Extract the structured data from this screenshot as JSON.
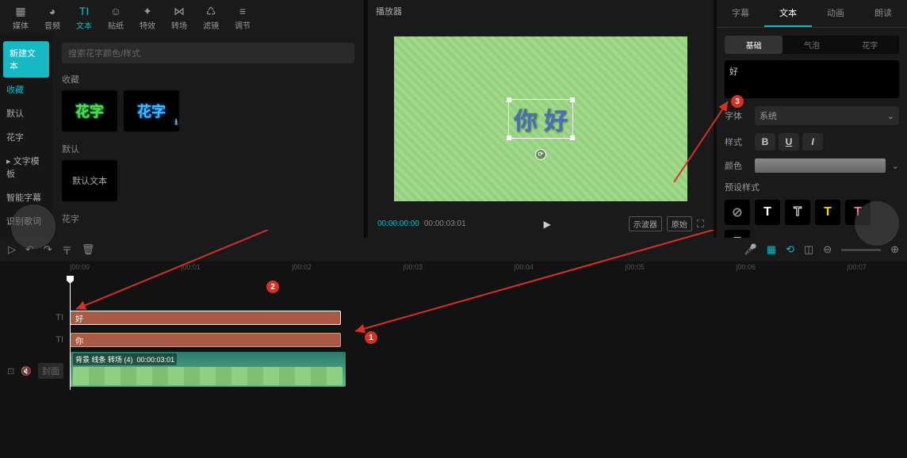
{
  "toolbar": [
    {
      "icon": "▦",
      "label": "媒体"
    },
    {
      "icon": "◕",
      "label": "音频"
    },
    {
      "icon": "TI",
      "label": "文本",
      "active": true
    },
    {
      "icon": "☺",
      "label": "贴纸"
    },
    {
      "icon": "✦",
      "label": "特效"
    },
    {
      "icon": "⋈",
      "label": "转场"
    },
    {
      "icon": "♺",
      "label": "滤镜"
    },
    {
      "icon": "≡",
      "label": "调节"
    }
  ],
  "sidebar": [
    {
      "label": "新建文本",
      "active": true
    },
    {
      "label": "收藏",
      "sel": true
    },
    {
      "label": "默认"
    },
    {
      "label": "花字"
    },
    {
      "label": "▸ 文字模板"
    },
    {
      "label": "智能字幕"
    },
    {
      "label": "识别歌词"
    }
  ],
  "search_placeholder": "搜索花字颜色/样式",
  "sections": {
    "fav": "收藏",
    "default": "默认",
    "huazi": "花字"
  },
  "assets": {
    "huazi1": "花字",
    "huazi2": "花字",
    "default_text": "默认文本"
  },
  "preview": {
    "title": "播放器",
    "canvas_text": "你 好",
    "current_time": "00:00:00:00",
    "duration": "00:00:03:01",
    "btn_oscilloscope": "示波器",
    "btn_original": "原始"
  },
  "right_tabs": [
    "字幕",
    "文本",
    "动画",
    "朗读"
  ],
  "sub_tabs": [
    "基础",
    "气泡",
    "花字"
  ],
  "text_value": "好",
  "props": {
    "font_label": "字体",
    "font_value": "系统",
    "style_label": "样式",
    "color_label": "颜色",
    "preset_label": "预设样式"
  },
  "presets": [
    {
      "char": "⊘",
      "color": "#888"
    },
    {
      "char": "T",
      "color": "#fff"
    },
    {
      "char": "T",
      "color": "#fff",
      "outline": true
    },
    {
      "char": "T",
      "color": "#ffcc00"
    },
    {
      "char": "T",
      "color": "#ff7a8a"
    },
    {
      "char": "T",
      "color": "#7ab8ff"
    }
  ],
  "timeline": {
    "cover_label": "封面",
    "ticks": [
      "00:00",
      "00:01",
      "00:02",
      "00:03",
      "00:04",
      "00:05",
      "00:06",
      "00:07"
    ],
    "tracks": {
      "text1": "好",
      "text2": "你",
      "video_label": "背景 线条 转场 (4)",
      "video_duration": "00:00:03:01"
    }
  },
  "annotations": [
    "1",
    "2",
    "3"
  ]
}
